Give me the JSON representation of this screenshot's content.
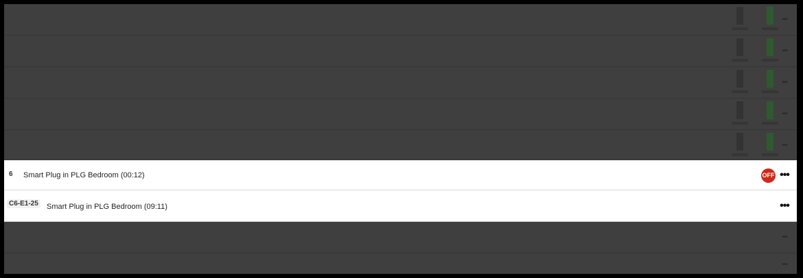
{
  "colors": {
    "overlay": "#3f3f3f",
    "active_row": "#ffffff",
    "off_badge": "#cc2a1a",
    "ctrl_gray": "#333333",
    "ctrl_green": "#2f5a2f"
  },
  "rows": [
    {
      "tag": "",
      "label": "",
      "dimmed": true,
      "controls": true
    },
    {
      "tag": "",
      "label": "",
      "dimmed": true,
      "controls": true
    },
    {
      "tag": "",
      "label": "",
      "dimmed": true,
      "controls": true
    },
    {
      "tag": "",
      "label": "",
      "dimmed": true,
      "controls": true
    },
    {
      "tag": "",
      "label": "",
      "dimmed": true,
      "controls": true
    },
    {
      "tag": "6",
      "label": "Smart Plug in PLG Bedroom (00:12)",
      "dimmed": false,
      "badge": "OFF",
      "more_icon": "more-horizontal-icon"
    },
    {
      "tag": "C6-E1-25",
      "label": "Smart Plug in PLG Bedroom (09:11)",
      "dimmed": false,
      "more_icon": "more-horizontal-icon"
    },
    {
      "tag": "",
      "label": "",
      "dimmed": true,
      "controls": false
    },
    {
      "tag": "",
      "label": "",
      "dimmed": true,
      "controls": false
    }
  ]
}
